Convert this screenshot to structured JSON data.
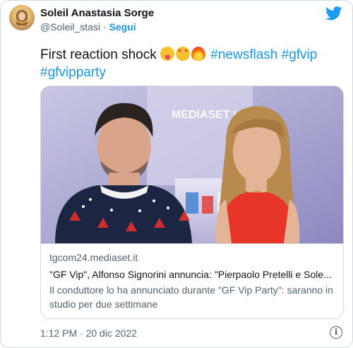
{
  "author": {
    "name": "Soleil Anastasia Sorge",
    "handle": "@Soleil_stasi",
    "separator": "·",
    "follow_label": "Segui"
  },
  "tweet": {
    "text_prefix": "First reaction shock",
    "emojis": [
      "squinting-tongue-face",
      "star-struck-face",
      "fire"
    ],
    "hashtags": [
      "#newsflash",
      "#gfvip",
      "#gfvipparty"
    ]
  },
  "card": {
    "image_overlay_text": "MEDIASET infinity",
    "domain": "tgcom24.mediaset.it",
    "title": "\"GF Vip\", Alfonso Signorini annuncia: \"Pierpaolo Pretelli e Sole...",
    "description": "Il conduttore lo ha annunciato durante \"GF Vip Party\": saranno in studio per due settimane"
  },
  "footer": {
    "timestamp": "1:12 PM · 20 dic 2022",
    "info_icon": "i"
  },
  "colors": {
    "accent": "#1b95e0",
    "text": "#0f1419",
    "muted": "#536471",
    "border": "#cfd9de"
  }
}
